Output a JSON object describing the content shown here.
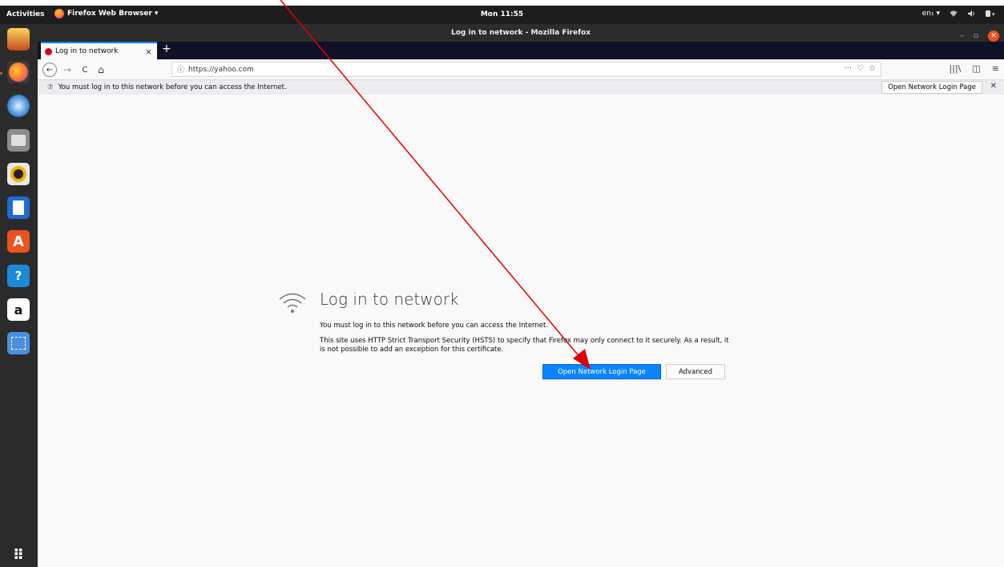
{
  "topbar": {
    "activities": "Activities",
    "app_name": "Firefox Web Browser ▾",
    "clock": "Mon 11:55",
    "lang": "en₁ ▾",
    "tray_icons": [
      "wifi-icon",
      "volume-icon",
      "battery-icon"
    ]
  },
  "dock": {
    "items": [
      "software-icon",
      "firefox-icon",
      "thunderbird-icon",
      "files-icon",
      "rhythmbox-icon",
      "writer-icon",
      "app-center-icon",
      "help-icon",
      "amazon-icon",
      "screenshot-icon"
    ],
    "help_glyph": "?",
    "amazon_glyph": "a",
    "apps_grid_glyph": "⠿"
  },
  "window": {
    "title": "Log in to network - Mozilla Firefox",
    "min": "–",
    "restore": "▫",
    "close": "✕"
  },
  "tab": {
    "label": "Log in to network",
    "close": "×",
    "new_tab": "+"
  },
  "nav": {
    "back": "←",
    "forward": "→",
    "reload": "C",
    "home": "⌂",
    "info_icon": "ⓘ",
    "url": "https://yahoo.com",
    "page_actions": "···",
    "pocket": "♡",
    "bookmark": "☆",
    "library": "|||\\",
    "sidebar": "◫",
    "menu": "≡"
  },
  "notice": {
    "icon": "⑦",
    "text": "You must log in to this network before you can access the Internet.",
    "button": "Open Network Login Page",
    "close": "✕"
  },
  "error_page": {
    "title": "Log in to network",
    "p1": "You must log in to this network before you can access the Internet.",
    "p2": "This site uses HTTP Strict Transport Security (HSTS) to specify that Firefox may only connect to it securely. As a result, it is not possible to add an exception for this certificate.",
    "primary_button": "Open Network Login Page",
    "secondary_button": "Advanced"
  },
  "colors": {
    "accent": "#0a84ff",
    "annotation": "#e00000",
    "ubuntu_orange": "#e95420"
  }
}
